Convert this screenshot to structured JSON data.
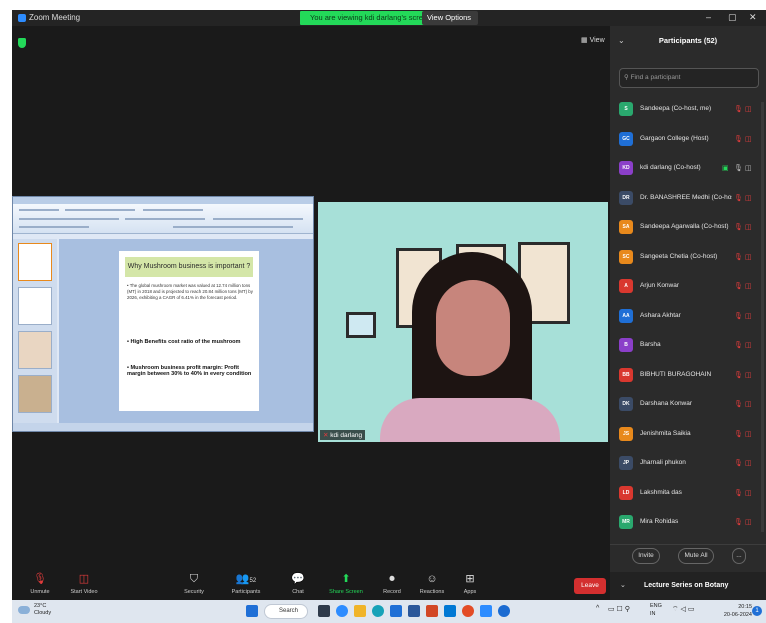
{
  "window": {
    "app_title": "Zoom Meeting",
    "viewing_banner": "You are viewing kdi darlang's screen",
    "view_options": "View Options",
    "view_button": "View"
  },
  "share": {
    "slide_title": "Why Mushroom business is important ?",
    "bullets": [
      "The global mushroom market was valued at 12.74 million tons (MT) in 2018 and is projected to reach 20.84 million tons (MT) by 2026, exhibiting a CAGR of 6.41% in the forecast period.",
      "High Benefits cost ratio of the mushroom",
      "Mushroom business profit margin: Profit margin between 30% to 40% in every condition"
    ]
  },
  "camera": {
    "name": "kdi darlang"
  },
  "participants": {
    "title": "Participants (52)",
    "search_placeholder": "Find a participant",
    "list": [
      {
        "initials": "S",
        "name": "Sandeepa (Co-host, me)",
        "color": "#2aa86e"
      },
      {
        "initials": "GC",
        "name": "Gargaon College (Host)",
        "color": "#1f6fd6"
      },
      {
        "initials": "KD",
        "name": "kdi darlang (Co-host)",
        "color": "#8b3fc9"
      },
      {
        "initials": "DR",
        "name": "Dr. BANASHREE Medhi (Co-host)",
        "color": "#3b4b66"
      },
      {
        "initials": "SA",
        "name": "Sandeepa Agarwalla (Co-host)",
        "color": "#e8891c"
      },
      {
        "initials": "SC",
        "name": "Sangeeta Chetia (Co-host)",
        "color": "#e8891c"
      },
      {
        "initials": "A",
        "name": "Arjun Konwar",
        "color": "#d9382f"
      },
      {
        "initials": "AA",
        "name": "Ashara Akhtar",
        "color": "#1f6fd6"
      },
      {
        "initials": "B",
        "name": "Barsha",
        "color": "#8b3fc9"
      },
      {
        "initials": "BB",
        "name": "BIBHUTI BURAGOHAIN",
        "color": "#d9382f"
      },
      {
        "initials": "DK",
        "name": "Darshana Konwar",
        "color": "#3b4b66"
      },
      {
        "initials": "JS",
        "name": "Jenishmita Saikia",
        "color": "#e8891c"
      },
      {
        "initials": "JP",
        "name": "Jharnali phukon",
        "color": "#3b4b66"
      },
      {
        "initials": "LD",
        "name": "Lakshmita das",
        "color": "#d9382f"
      },
      {
        "initials": "MR",
        "name": "Mira Rohidas",
        "color": "#2aa86e"
      }
    ],
    "invite": "Invite",
    "mute_all": "Mute All",
    "more": "..."
  },
  "toolbar": {
    "unmute": "Unmute",
    "start_video": "Start Video",
    "security": "Security",
    "participants": "Participants",
    "participants_count": "52",
    "chat": "Chat",
    "share_screen": "Share Screen",
    "record": "Record",
    "reactions": "Reactions",
    "apps": "Apps",
    "leave": "Leave"
  },
  "side_footer": {
    "lecture_title": "Lecture Series on Botany"
  },
  "taskbar": {
    "temperature": "23°C",
    "weather": "Cloudy",
    "search": "Search",
    "language": "ENG",
    "region": "IN",
    "time": "20:15",
    "date": "20-06-2024",
    "notifications": "1"
  },
  "colors": {
    "green": "#23d959",
    "leave_red": "#d32f2f",
    "mic_off_red": "#e23c3c"
  }
}
